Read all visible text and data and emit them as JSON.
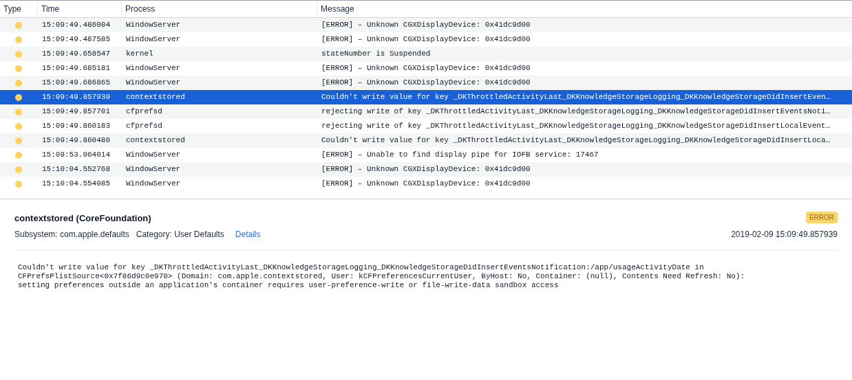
{
  "table": {
    "columns": [
      "Type",
      "Time",
      "Process",
      "Message"
    ],
    "rows": [
      {
        "time": "15:09:49.486004",
        "process": "WindowServer",
        "message": "[ERROR] – Unknown CGXDisplayDevice: 0x41dc9d00",
        "selected": false
      },
      {
        "time": "15:09:49.487585",
        "process": "WindowServer",
        "message": "[ERROR] – Unknown CGXDisplayDevice: 0x41dc9d00",
        "selected": false
      },
      {
        "time": "15:09:49.658547",
        "process": "kernel",
        "message": "stateNumber is Suspended",
        "selected": false
      },
      {
        "time": "15:09:49.685181",
        "process": "WindowServer",
        "message": "[ERROR] – Unknown CGXDisplayDevice: 0x41dc9d00",
        "selected": false
      },
      {
        "time": "15:09:49.686865",
        "process": "WindowServer",
        "message": "[ERROR] – Unknown CGXDisplayDevice: 0x41dc9d00",
        "selected": false
      },
      {
        "time": "15:09:49.857939",
        "process": "contextstored",
        "message": "Couldn't write value for key _DKThrottledActivityLast_DKKnowledgeStorageLogging_DKKnowledgeStorageDidInsertEven…",
        "selected": true
      },
      {
        "time": "15:09:49.857701",
        "process": "cfprefsd",
        "message": "rejecting write of key _DKThrottledActivityLast_DKKnowledgeStorageLogging_DKKnowledgeStorageDidInsertEventsNoti…",
        "selected": false
      },
      {
        "time": "15:09:49.860183",
        "process": "cfprefsd",
        "message": "rejecting write of key _DKThrottledActivityLast_DKKnowledgeStorageLogging_DKKnowledgeStorageDidInsertLocalEvent…",
        "selected": false
      },
      {
        "time": "15:09:49.860480",
        "process": "contextstored",
        "message": "Couldn't write value for key _DKThrottledActivityLast_DKKnowledgeStorageLogging_DKKnowledgeStorageDidInsertLoca…",
        "selected": false
      },
      {
        "time": "15:09:53.064014",
        "process": "WindowServer",
        "message": "[ERROR] – Unable to find display pipe for IOFB service: 17467",
        "selected": false
      },
      {
        "time": "15:10:04.552768",
        "process": "WindowServer",
        "message": "[ERROR] – Unknown CGXDisplayDevice: 0x41dc9d00",
        "selected": false
      },
      {
        "time": "15:10:04.554085",
        "process": "WindowServer",
        "message": "[ERROR] – Unknown CGXDisplayDevice: 0x41dc9d00",
        "selected": false
      }
    ]
  },
  "detail": {
    "title": "contextstored (CoreFoundation)",
    "badge": "ERROR",
    "meta": [
      {
        "label": "Subsystem:",
        "value": "com.apple.defaults"
      },
      {
        "label": "Category:",
        "value": "User Defaults"
      }
    ],
    "link": "Details",
    "timestamp": "2019-02-09 15:09:49.857939",
    "body": "Couldn't write value for key _DKThrottledActivityLast_DKKnowledgeStorageLogging_DKKnowledgeStorageDidInsertEventsNotification:/app/usageActivityDate in CFPrefsPlistSource<0x7f86d9c0e970> (Domain: com.apple.contextstored, User: kCFPreferencesCurrentUser, ByHost: No, Container: (null), Contents Need Refresh: No): setting preferences outside an application's container requires user-preference-write or file-write-data sandbox access"
  }
}
